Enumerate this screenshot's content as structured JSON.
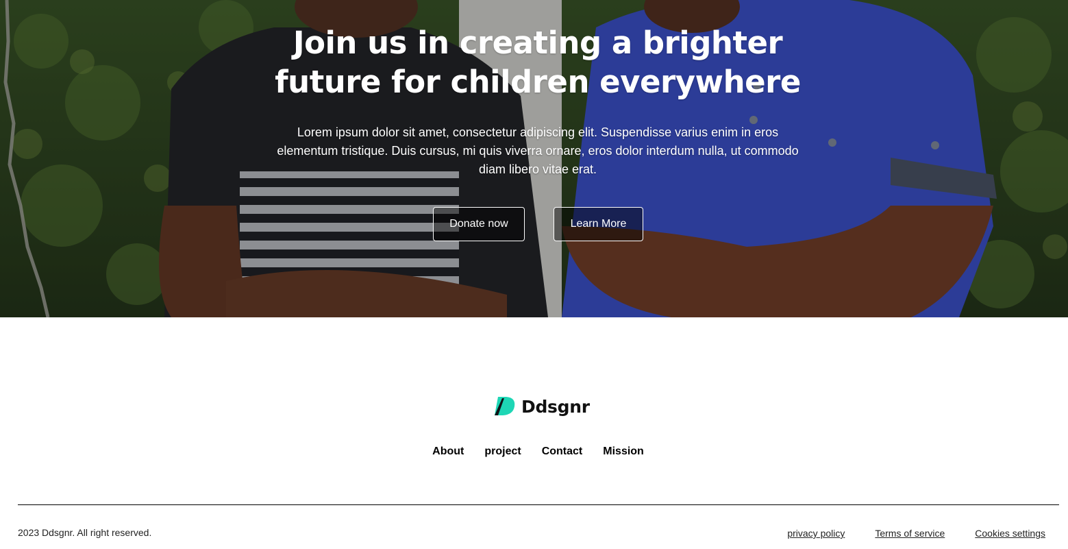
{
  "hero": {
    "title": "Join us in creating a brighter future for children everywhere",
    "text": "Lorem ipsum dolor sit amet, consectetur adipiscing elit. Suspendisse varius enim in eros elementum tristique. Duis cursus, mi quis viverra ornare, eros dolor interdum nulla, ut commodo diam libero vitae erat.",
    "donate_label": "Donate now",
    "learn_label": "Learn More"
  },
  "footer": {
    "brand": "Ddsgnr",
    "nav": [
      "About",
      "project",
      "Contact",
      "Mission"
    ],
    "copyright": "2023 Ddsgnr. All right reserved.",
    "legal": [
      "privacy policy",
      "Terms of service",
      "Cookies settings"
    ]
  },
  "colors": {
    "logo_accent": "#1ed6b5",
    "text_dark": "#000000"
  },
  "icons": {
    "logo": "ddsgnr-logo-icon"
  }
}
